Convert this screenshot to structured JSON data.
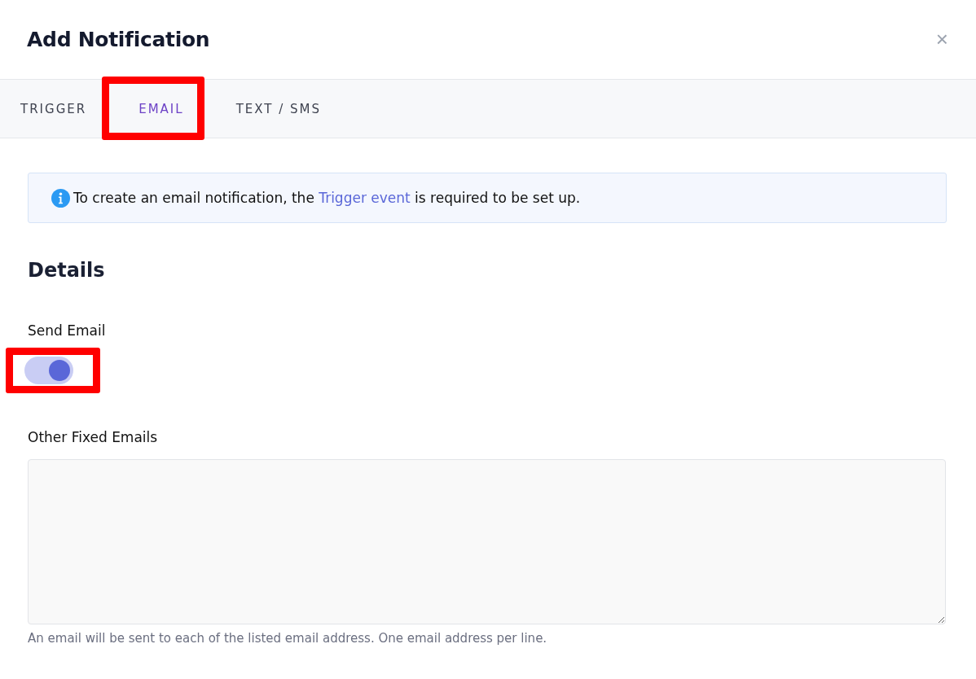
{
  "dialog": {
    "title": "Add Notification",
    "close": "×"
  },
  "tabs": [
    {
      "label": "TRIGGER",
      "selected": false,
      "highlighted": false
    },
    {
      "label": "EMAIL",
      "selected": true,
      "highlighted": true
    },
    {
      "label": "TEXT / SMS",
      "selected": false,
      "highlighted": false
    }
  ],
  "alert": {
    "before": "To create an email notification, the ",
    "link": "Trigger event",
    "after": " is required to be set up."
  },
  "section_title": "Details",
  "send_email": {
    "label": "Send Email",
    "on": true,
    "highlighted": true
  },
  "other_emails": {
    "label": "Other Fixed Emails",
    "help": "An email will be sent to each of the listed email address. One email address per line."
  }
}
